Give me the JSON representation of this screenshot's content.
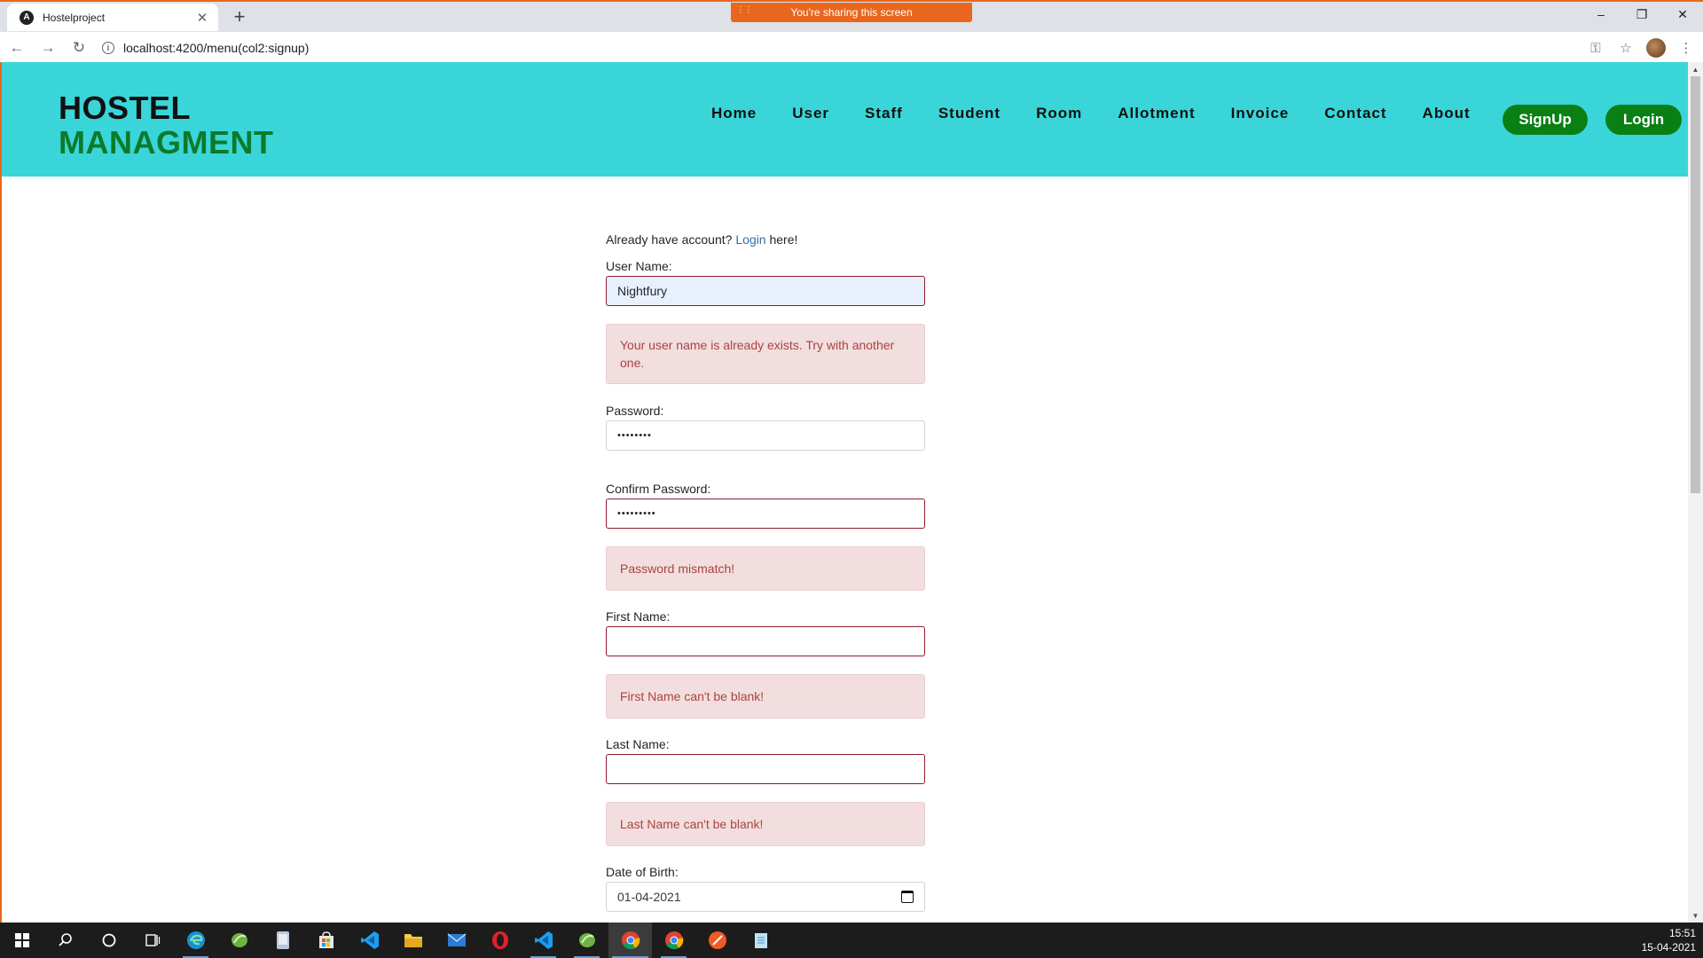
{
  "browser": {
    "tab_title": "Hostelproject",
    "url": "localhost:4200/menu(col2:signup)",
    "share_banner": "You're sharing this screen"
  },
  "navbar": {
    "brand_line1": "HOSTEL",
    "brand_line2": "MANAGMENT",
    "links": [
      "Home",
      "User",
      "Staff",
      "Student",
      "Room",
      "Allotment",
      "Invoice",
      "Contact",
      "About"
    ],
    "signup_label": "SignUp",
    "login_label": "Login"
  },
  "form": {
    "login_hint_prefix": "Already have account?",
    "login_hint_link": "Login",
    "login_hint_suffix": "here!",
    "username_label": "User Name:",
    "username_value": "Nightfury",
    "username_error": "Your user name is already exists. Try with another one.",
    "password_label": "Password:",
    "password_value": "••••••••",
    "confirm_label": "Confirm Password:",
    "confirm_value": "•••••••••",
    "confirm_error": "Password mismatch!",
    "firstname_label": "First Name:",
    "firstname_value": "",
    "firstname_error": "First Name can't be blank!",
    "lastname_label": "Last Name:",
    "lastname_value": "",
    "lastname_error": "Last Name can't be blank!",
    "dob_label": "Date of Birth:",
    "dob_value": "01-04-2021"
  },
  "taskbar": {
    "time": "15:51",
    "date": "15-04-2021",
    "apps": [
      "edge",
      "spring",
      "file",
      "store",
      "vscode",
      "explorer",
      "mail",
      "opera",
      "vscode2",
      "spring2",
      "chrome-active",
      "chrome",
      "postman",
      "notepad"
    ]
  },
  "colors": {
    "navbar_bg": "#3ad5d9",
    "brand_green": "#0c7a2b",
    "button_green": "#0a7f14",
    "alert_bg": "#f2dede",
    "alert_text": "#a94442",
    "share_orange": "#e8671d"
  }
}
